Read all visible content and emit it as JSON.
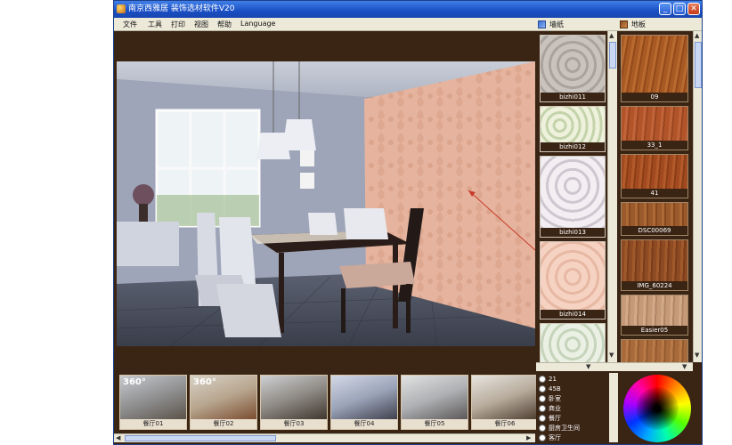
{
  "window": {
    "title": "南京西雅居 装饰选材软件V20",
    "controls": {
      "minimize": "_",
      "maximize": "□",
      "close": "✕"
    }
  },
  "menu": [
    "文件",
    "工具",
    "打印",
    "视图",
    "帮助",
    "Language"
  ],
  "panels": {
    "wallpaper_tab": "墙纸",
    "floor_tab": "地板"
  },
  "wallpapers": [
    {
      "label": "bizhi011",
      "color": "#b8b2ad"
    },
    {
      "label": "bizhi012",
      "color": "#dbe3c6"
    },
    {
      "label": "bizhi013",
      "color": "#ebe6ea"
    },
    {
      "label": "bizhi014",
      "color": "#f2c9b5"
    },
    {
      "label": "",
      "color": "#dde6d5"
    }
  ],
  "floors": [
    {
      "label": "09",
      "color": "#a85a24"
    },
    {
      "label": "33_1",
      "color": "#b2542a"
    },
    {
      "label": "41",
      "color": "#a14a1f"
    },
    {
      "label": "DSC00069",
      "color": "#9a5a2c"
    },
    {
      "label": "IMG_60224",
      "color": "#8e4a22"
    },
    {
      "label": "Easier05",
      "color": "#c49a78"
    },
    {
      "label": "",
      "color": "#a86a3a"
    }
  ],
  "room_types": [
    "21",
    "45B",
    "卧室",
    "商业",
    "餐厅",
    "厨房卫生间",
    "客厅"
  ],
  "scenes": [
    {
      "label": "餐厅01",
      "badge": "360°"
    },
    {
      "label": "餐厅02",
      "badge": "360°"
    },
    {
      "label": "餐厅03",
      "badge": ""
    },
    {
      "label": "餐厅04",
      "badge": ""
    },
    {
      "label": "餐厅05",
      "badge": ""
    },
    {
      "label": "餐厅06",
      "badge": ""
    }
  ],
  "colors": {
    "accent_wall": "#e6b49e",
    "frame_brown": "#3a2414",
    "titlebar": "#1a4fc4"
  }
}
